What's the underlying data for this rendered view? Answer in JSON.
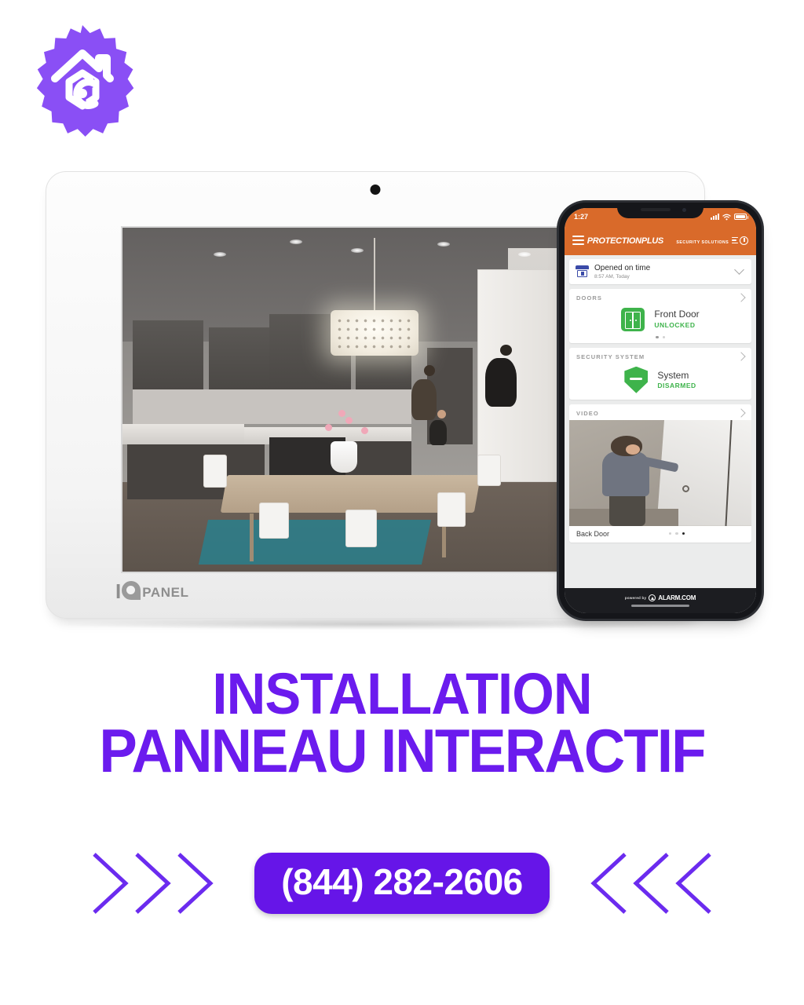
{
  "brand": {
    "badge_icon": "home-camera-badge-icon",
    "badge_color": "#8A4FF5"
  },
  "theme": {
    "purple": "#6615E8",
    "headline_purple": "#6B1BEE",
    "orange": "#D96A2A",
    "green": "#3EB34B"
  },
  "tablet": {
    "brand_i": "I",
    "brand_panel": "PANEL",
    "camera_icon": "front-camera-dot-icon",
    "screen_alt": "kitchen-dining-room-camera-feed"
  },
  "phone": {
    "status": {
      "time": "1:27",
      "signal_icon": "cellular-signal-icon",
      "wifi_icon": "wifi-icon",
      "battery_icon": "battery-full-icon"
    },
    "appbar": {
      "menu_icon": "hamburger-menu-icon",
      "brand_line1": "PROTECTIONPLUS",
      "brand_line2": "SECURITY SOLUTIONS",
      "actions_icon": "activity-settings-icon"
    },
    "notice": {
      "icon": "business-open-icon",
      "title": "Opened on time",
      "subtitle": "8:57 AM, Today",
      "expand_icon": "chevron-down-icon"
    },
    "sections": [
      {
        "title": "DOORS",
        "chevron_icon": "chevron-right-icon",
        "device_icon": "double-door-icon",
        "device_name": "Front Door",
        "device_state": "UNLOCKED",
        "dots": 2,
        "active_dot": 0
      },
      {
        "title": "SECURITY SYSTEM",
        "chevron_icon": "chevron-right-icon",
        "device_icon": "shield-disarmed-icon",
        "device_name": "System",
        "device_state": "DISARMED"
      },
      {
        "title": "VIDEO",
        "chevron_icon": "chevron-right-icon",
        "camera_label": "Back Door",
        "dots": 3,
        "active_dot": 2
      }
    ],
    "footer": {
      "powered_by": "powered by",
      "partner": "ALARM.COM",
      "mark_icon": "alarm-dot-com-icon",
      "home_indicator": "home-indicator"
    }
  },
  "headline": {
    "line1": "INSTALLATION",
    "line2": "PANNEAU INTERACTIF"
  },
  "cta": {
    "phone_number": "(844) 282-2606",
    "left_arrows_icon": "chevrons-right-icon",
    "right_arrows_icon": "chevrons-left-icon"
  }
}
